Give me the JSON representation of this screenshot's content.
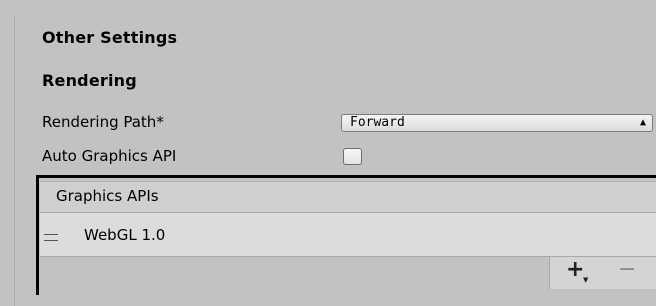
{
  "inspector": {
    "section_title": "Other Settings",
    "group_title": "Rendering",
    "properties": {
      "rendering_path": {
        "label": "Rendering Path*",
        "value": "Forward"
      },
      "auto_graphics_api": {
        "label": "Auto Graphics API",
        "checked": false
      }
    },
    "graphics_apis": {
      "header": "Graphics APIs",
      "items": [
        {
          "label": "WebGL 1.0"
        }
      ],
      "add_label": "+",
      "remove_label": "−"
    }
  }
}
